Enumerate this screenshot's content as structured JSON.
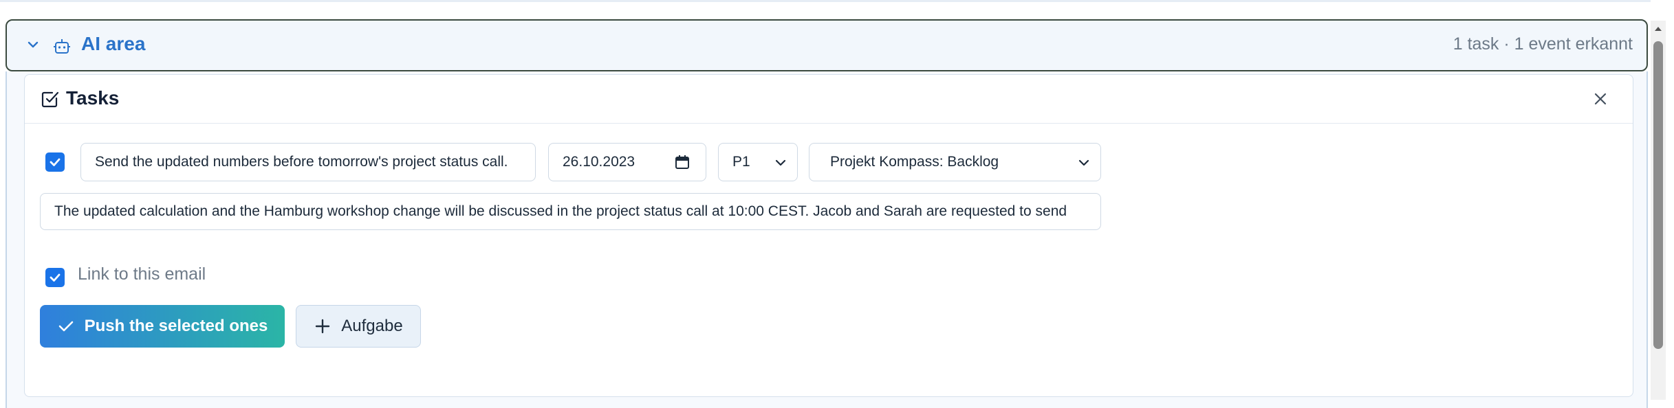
{
  "ai_area": {
    "title": "AI area",
    "status": "1 task · 1 event erkannt"
  },
  "tasks": {
    "title": "Tasks",
    "task": {
      "checked": true,
      "title_value": "Send the updated numbers before tomorrow's project status call.",
      "due_date": "26.10.2023",
      "priority": "P1",
      "list": "Projekt Kompass: Backlog",
      "description": "The updated calculation and the Hamburg workshop change will be discussed in the project status call at 10:00 CEST. Jacob and Sarah are requested to send"
    },
    "link_email": {
      "checked": true,
      "label": "Link to this email"
    },
    "push_button": "Push the selected ones",
    "add_button": "Aufgabe"
  },
  "colors": {
    "accent": "#1a73e8",
    "title_blue": "#2a73c9",
    "gradient_start": "#2f7fdd",
    "gradient_end": "#2bb5a6"
  },
  "icons": {
    "collapse": "chevron-down-icon",
    "ai": "robot-icon",
    "tasks": "check-square-icon",
    "close": "close-icon",
    "push": "check-icon",
    "add": "plus-icon"
  }
}
